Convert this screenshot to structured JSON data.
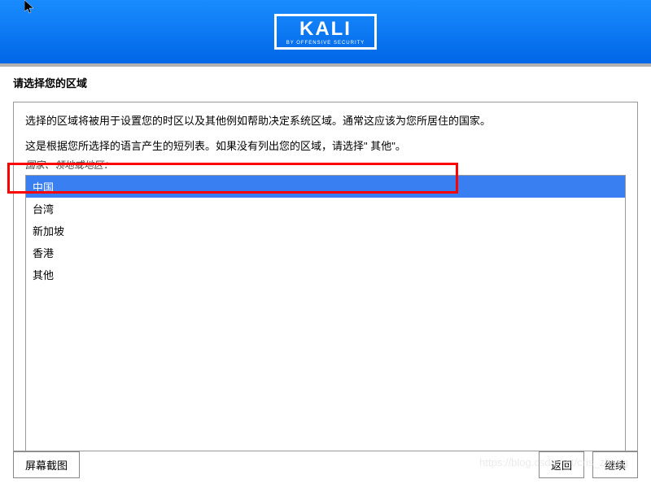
{
  "logo": {
    "main": "KALI",
    "sub": "BY OFFENSIVE SECURITY"
  },
  "title": "请选择您的区域",
  "desc1": "选择的区域将被用于设置您的时区以及其他例如帮助决定系统区域。通常这应该为您所居住的国家。",
  "desc2": "这是根据您所选择的语言产生的短列表。如果没有列出您的区域，请选择\" 其他\"。",
  "listlabel": "国家、领地或地区：",
  "items": [
    "中国",
    "台湾",
    "新加坡",
    "香港",
    "其他"
  ],
  "selectedIndex": 0,
  "buttons": {
    "screenshot": "屏幕截图",
    "back": "返回",
    "continue": "继续"
  },
  "watermark": "https://blog.csdn.net/cris_zhang"
}
